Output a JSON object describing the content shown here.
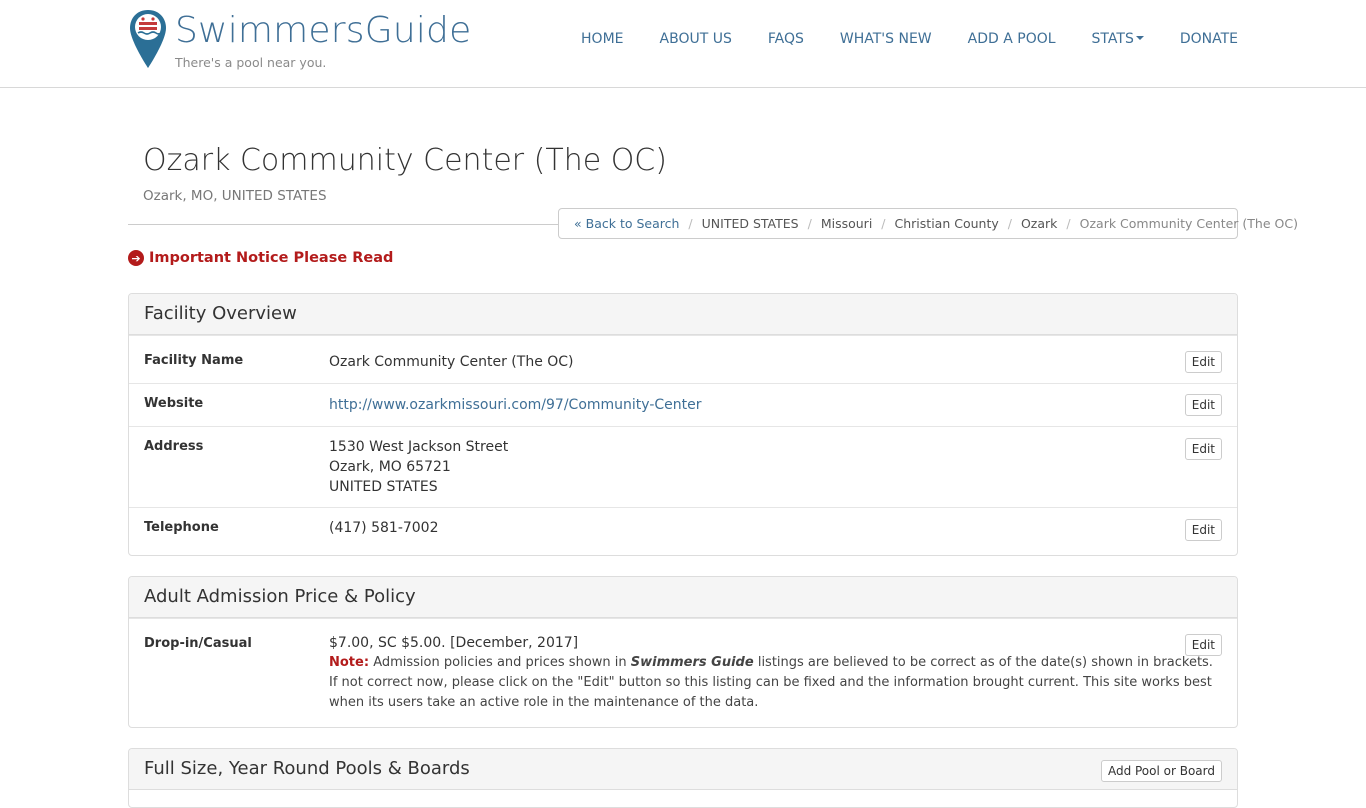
{
  "header": {
    "brand": "SwimmersGuide",
    "tagline": "There's a pool near you.",
    "nav": [
      "HOME",
      "ABOUT US",
      "FAQS",
      "WHAT'S NEW",
      "ADD A POOL",
      "STATS",
      "DONATE"
    ]
  },
  "page": {
    "title": "Ozark Community Center (The OC)",
    "subtitle": "Ozark, MO, UNITED STATES"
  },
  "breadcrumb": {
    "back": "« Back to Search",
    "country": "UNITED STATES",
    "state": "Missouri",
    "county": "Christian County",
    "city": "Ozark",
    "current": "Ozark Community Center (The OC)"
  },
  "notice": "Important Notice Please Read",
  "overview": {
    "heading": "Facility Overview",
    "edit_label": "Edit",
    "rows": [
      {
        "label": "Facility Name",
        "value": "Ozark Community Center (The OC)"
      },
      {
        "label": "Website",
        "value": "http://www.ozarkmissouri.com/97/Community-Center"
      },
      {
        "label": "Address",
        "line1": "1530 West Jackson Street",
        "line2": "Ozark, MO 65721",
        "line3": "UNITED STATES"
      },
      {
        "label": "Telephone",
        "value": "(417) 581-7002"
      }
    ]
  },
  "admission": {
    "heading": "Adult Admission Price & Policy",
    "edit_label": "Edit",
    "label": "Drop-in/Casual",
    "price": "$7.00, SC $5.00. [December, 2017]",
    "note_label": "Note:",
    "note_a": "Admission policies and prices shown in",
    "note_brand": "Swimmers Guide",
    "note_b": "listings are believed to be correct as of the date(s) shown in brackets. If not correct now, please click on the \"Edit\" button so this listing can be fixed and the information brought current. This site works best when its users take an active role in the maintenance of the data."
  },
  "pools": {
    "heading": "Full Size, Year Round Pools & Boards",
    "add_button": "Add Pool or Board"
  },
  "colors": {
    "brand_blue": "#3f6f96",
    "notice_red": "#b31b1b"
  }
}
